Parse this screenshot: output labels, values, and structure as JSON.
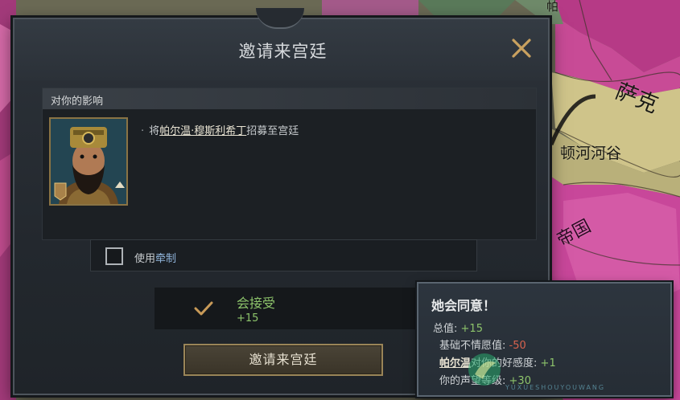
{
  "map": {
    "regions": [
      "帕",
      "萨克",
      "顿河河谷",
      "帝国"
    ]
  },
  "dialog": {
    "title": "邀请来宫廷",
    "effect_header": "对你的影响",
    "effect_bullet": "·",
    "effect_prefix": "将",
    "effect_character": "帕尔温·穆斯利希丁",
    "effect_suffix": "招募至宫廷",
    "hook_label_prefix": "使用",
    "hook_label_link": "牵制",
    "hook_checked": false,
    "accept_title": "会接受",
    "accept_score": "+15",
    "invite_button": "邀请来宫廷"
  },
  "tooltip": {
    "title": "她会同意！",
    "total_label": "总值:",
    "total_value": "+15",
    "base_label": "基础不情愿值:",
    "base_value": "-50",
    "opinion_character": "帕尔温",
    "opinion_label": "对你的好感度:",
    "opinion_value": "+1",
    "prestige_label": "你的声望等级:",
    "prestige_value": "+30"
  },
  "watermark": {
    "text": "YUXUESHOUYOUWANG"
  },
  "colors": {
    "positive": "#8dc46b",
    "negative": "#d9634e",
    "gold_border": "#9a8558"
  }
}
